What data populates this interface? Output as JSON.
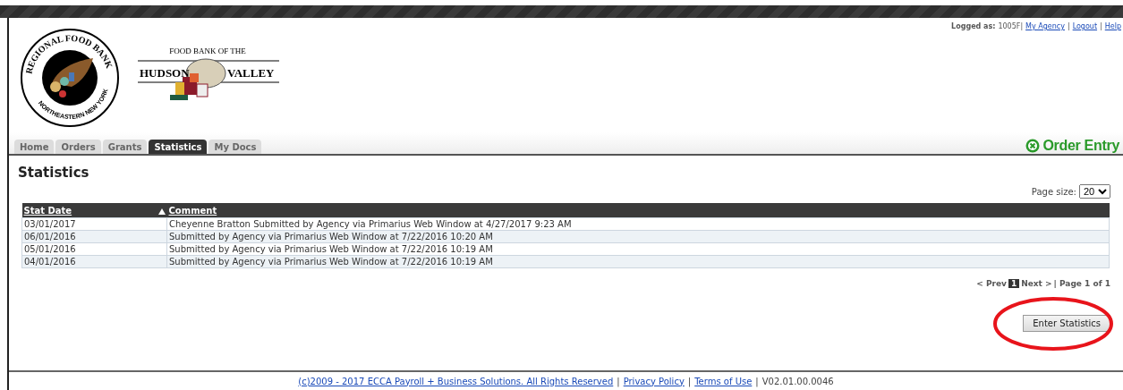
{
  "header": {
    "logged_as_label": "Logged as:",
    "user": "1005F|",
    "links": [
      "My Agency",
      "Logout",
      "Help"
    ],
    "separator": "|",
    "logos": [
      {
        "kind": "regional",
        "texts": [
          "REGIONAL FOOD BANK",
          "NORTHEASTERN NEW YORK"
        ]
      },
      {
        "kind": "hudson",
        "texts": [
          "FOOD BANK OF THE",
          "HUDSON",
          "VALLEY"
        ]
      }
    ]
  },
  "tabs": [
    {
      "label": "Home",
      "selected": false
    },
    {
      "label": "Orders",
      "selected": false
    },
    {
      "label": "Grants",
      "selected": false
    },
    {
      "label": "Statistics",
      "selected": true
    },
    {
      "label": "My Docs",
      "selected": false
    }
  ],
  "order_entry": "Order Entry",
  "page_title": "Statistics",
  "page_size": {
    "label": "Page size:",
    "value": "20"
  },
  "table": {
    "columns": [
      {
        "label": "Stat Date",
        "sorted_ascending": true
      },
      {
        "label": "Comment",
        "sorted_ascending": false
      }
    ],
    "rows": [
      {
        "cells": [
          "03/01/2017",
          "Cheyenne Bratton Submitted by Agency via Primarius Web Window at 4/27/2017 9:23 AM"
        ]
      },
      {
        "cells": [
          "06/01/2016",
          "Submitted by Agency via Primarius Web Window at 7/22/2016 10:20 AM"
        ]
      },
      {
        "cells": [
          "05/01/2016",
          "Submitted by Agency via Primarius Web Window at 7/22/2016 10:19 AM"
        ]
      },
      {
        "cells": [
          "04/01/2016",
          "Submitted by Agency via Primarius Web Window at 7/22/2016 10:19 AM"
        ]
      }
    ]
  },
  "pager": {
    "prev": "< Prev",
    "pages": [
      {
        "label": "1",
        "selected": true
      }
    ],
    "next": "Next >",
    "summary": "| Page 1 of 1"
  },
  "enter_button": {
    "label": "Enter Statistics",
    "highlighted": true
  },
  "footer": {
    "copyright": "(c)2009 - 2017 ECCA Payroll + Business Solutions. All Rights Reserved",
    "links": [
      "Privacy Policy",
      "Terms of Use"
    ],
    "separator": "|",
    "version": "V02.01.00.0046"
  }
}
